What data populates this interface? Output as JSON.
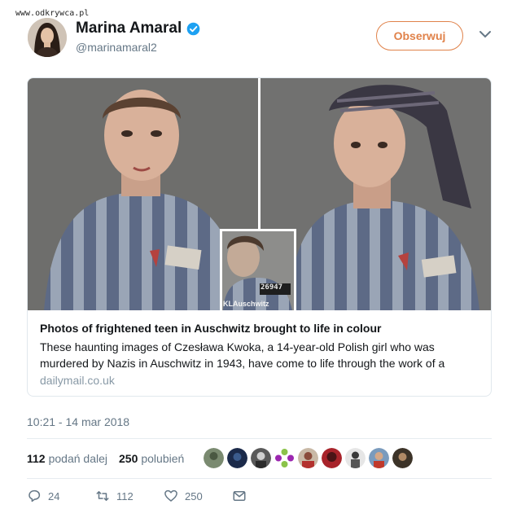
{
  "watermark": "www.odkrywca.pl",
  "author": {
    "name": "Marina Amaral",
    "handle": "@marinamaral2",
    "verified_icon": "verified-badge-icon"
  },
  "follow_label": "Obserwuj",
  "card": {
    "title": "Photos of frightened teen in Auschwitz brought to life in colour",
    "description": "These haunting images of Czesława Kwoka, a 14-year-old Polish girl who was murdered by Nazis in Auschwitz in 1943, have come to life through the work of a",
    "domain": "dailymail.co.uk",
    "inset_number": "26947",
    "inset_caption": "KLAuschwitz"
  },
  "timestamp": "10:21 - 14 mar 2018",
  "stats": {
    "retweets_count": "112",
    "retweets_label": "podań dalej",
    "likes_count": "250",
    "likes_label": "polubień"
  },
  "actions": {
    "replies": "24",
    "retweets": "112",
    "likes": "250"
  },
  "colors": {
    "accent": "#e0824a",
    "verified": "#1da1f2",
    "secondary_text": "#657786"
  }
}
